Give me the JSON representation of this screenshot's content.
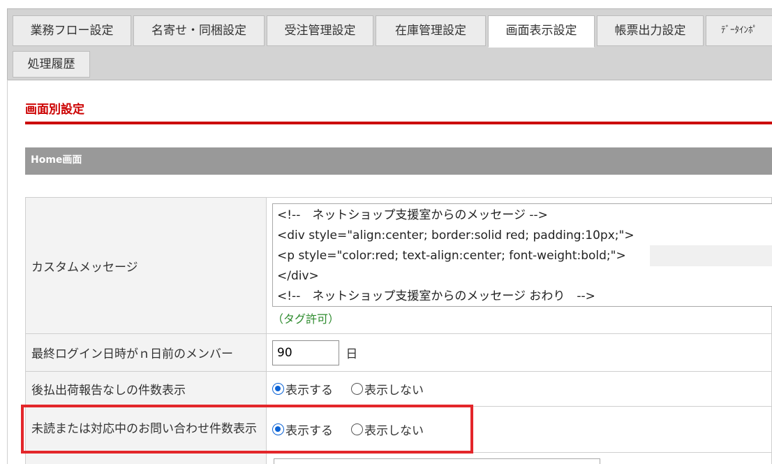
{
  "tabs": [
    {
      "label": "業務フロー設定",
      "active": false
    },
    {
      "label": "名寄せ・同梱設定",
      "active": false
    },
    {
      "label": "受注管理設定",
      "active": false
    },
    {
      "label": "在庫管理設定",
      "active": false
    },
    {
      "label": "画面表示設定",
      "active": true
    },
    {
      "label": "帳票出力設定",
      "active": false
    },
    {
      "label": "ﾃﾞｰﾀｲﾝﾎﾟ",
      "active": false
    }
  ],
  "tabs_row2": [
    {
      "label": "処理履歴",
      "active": false
    }
  ],
  "section": {
    "title": "画面別設定",
    "subheading": "Home画面"
  },
  "custom_message": {
    "label": "カスタムメッセージ",
    "lines": [
      "<!--　ネットショップ支援室からのメッセージ -->",
      "<div style=\"align:center; border:solid red; padding:10px;\">",
      "<p style=\"color:red; text-align:center; font-weight:bold;\">",
      "</div>",
      "<!--　ネットショップ支援室からのメッセージ おわり　-->"
    ],
    "note": "（タグ許可）"
  },
  "last_login": {
    "label": "最終ログイン日時がｎ日前のメンバー",
    "value": "90",
    "unit": "日"
  },
  "deferred_payment": {
    "label": "後払出荷報告なしの件数表示",
    "options": [
      "表示する",
      "表示しない"
    ],
    "selected": "表示する"
  },
  "unread_inquiries": {
    "label": "未読または対応中のお問い合わせ件数表示",
    "options": [
      "表示する",
      "表示しない"
    ],
    "selected": "表示する"
  },
  "colors": {
    "accent_red": "#cc0000",
    "highlight": "#e3262a",
    "note_green": "#2e8b2e",
    "radio_blue": "#0b63d6"
  }
}
